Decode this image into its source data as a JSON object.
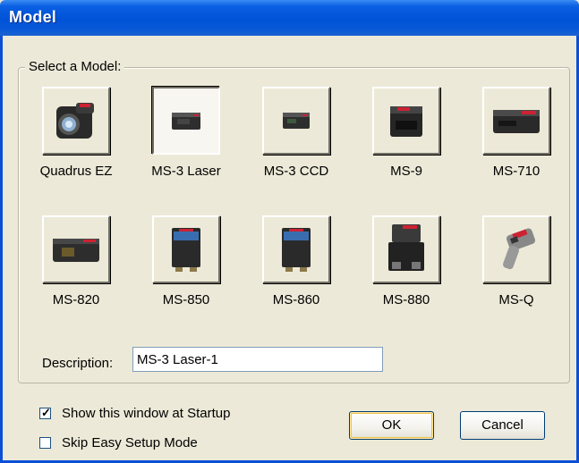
{
  "window": {
    "title": "Model"
  },
  "group": {
    "label": "Select a Model:"
  },
  "models": [
    {
      "label": "Quadrus EZ",
      "icon": "quadrus-ez-scanner-icon"
    },
    {
      "label": "MS-3 Laser",
      "icon": "ms3-laser-scanner-icon",
      "selected": true
    },
    {
      "label": "MS-3 CCD",
      "icon": "ms3-ccd-scanner-icon"
    },
    {
      "label": "MS-9",
      "icon": "ms9-scanner-icon"
    },
    {
      "label": "MS-710",
      "icon": "ms710-scanner-icon"
    },
    {
      "label": "MS-820",
      "icon": "ms820-scanner-icon"
    },
    {
      "label": "MS-850",
      "icon": "ms850-scanner-icon"
    },
    {
      "label": "MS-860",
      "icon": "ms860-scanner-icon"
    },
    {
      "label": "MS-880",
      "icon": "ms880-scanner-icon"
    },
    {
      "label": "MS-Q",
      "icon": "msq-handheld-scanner-icon"
    }
  ],
  "description": {
    "label": "Description:",
    "value": "MS-3 Laser-1"
  },
  "options": {
    "show_startup": {
      "label": "Show this window at Startup",
      "checked": true
    },
    "skip_easy_setup": {
      "label": "Skip Easy Setup Mode",
      "checked": false
    }
  },
  "buttons": {
    "ok": "OK",
    "cancel": "Cancel"
  }
}
